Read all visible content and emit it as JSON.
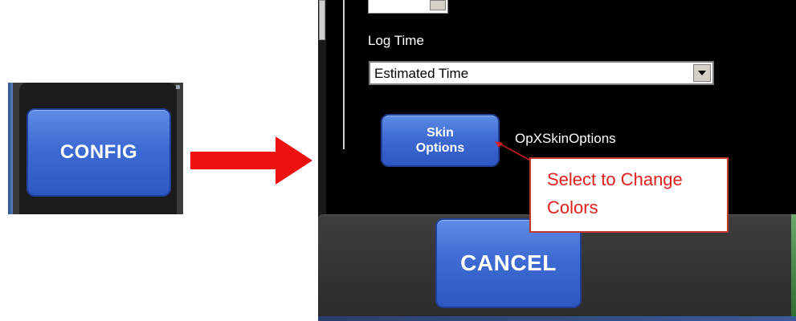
{
  "left_panel": {
    "config_button_label": "CONFIG"
  },
  "dialog": {
    "log_time_label": "Log Time",
    "log_time_select": {
      "selected": "Estimated Time"
    },
    "skin_options_button": {
      "line1": "Skin",
      "line2": "Options"
    },
    "skin_options_name": "OpXSkinOptions",
    "cancel_button_label": "CANCEL"
  },
  "annotation": {
    "line1": "Select to Change",
    "line2": "Colors"
  },
  "colors": {
    "button_blue": "#3e6bd3",
    "arrow_red": "#ee1111",
    "callout_red": "#e0201c",
    "dialog_bg": "#000000"
  },
  "icons": [
    "right-arrow-icon",
    "dropdown-arrow-icon",
    "pointer-arrow-icon"
  ]
}
